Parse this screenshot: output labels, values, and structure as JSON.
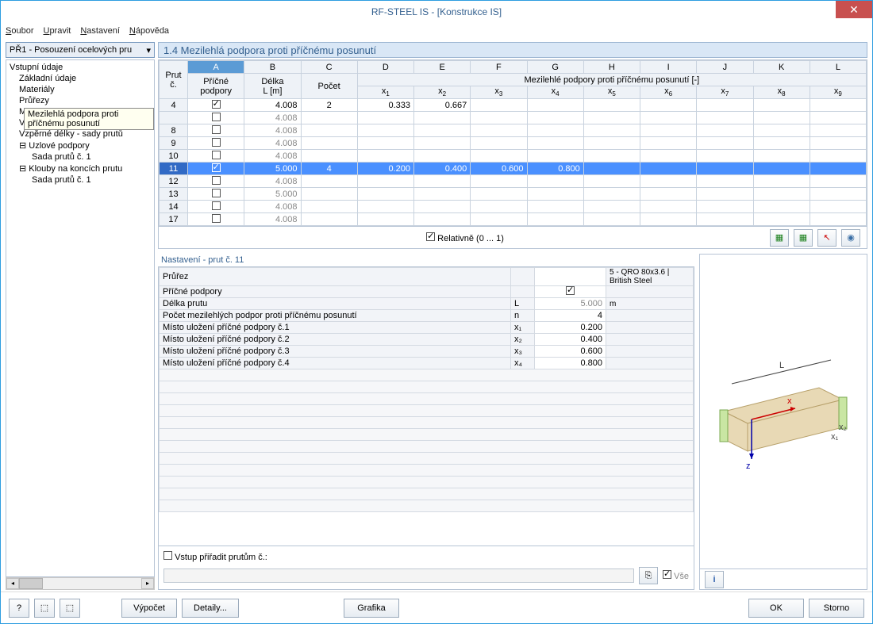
{
  "title": "RF-STEEL IS - [Konstrukce IS]",
  "menu": {
    "soubor": "Soubor",
    "upravit": "Upravit",
    "nastaveni": "Nastavení",
    "napoveda": "Nápověda"
  },
  "combo": "PŘ1 - Posouzení ocelových pru",
  "tree": {
    "root": "Vstupní údaje",
    "items": [
      "Základní údaje",
      "Materiály",
      "Průřezy",
      "Mezilehlá podpora proti příčnému posunutí",
      "Vzpěrné délky - pruty",
      "Vzpěrné délky - sady prutů"
    ],
    "uzlove": "Uzlové podpory",
    "sada1": "Sada prutů č. 1",
    "klouby": "Klouby na koncích prutu",
    "sada2": "Sada prutů č. 1",
    "tooltip": "Mezilehlá podpora proti příčnému posunutí"
  },
  "section_title": "1.4 Mezilehlá podpora proti příčnému posunutí",
  "grid": {
    "cols_letters": [
      "A",
      "B",
      "C",
      "D",
      "E",
      "F",
      "G",
      "H",
      "I",
      "J",
      "K",
      "L"
    ],
    "h_prut": "Prut č.",
    "h_pricne": "Příčné podpory",
    "h_delka": "Délka L [m]",
    "h_pocet": "Počet",
    "h_group": "Mezilehlé podpory proti příčnému posunutí [-]",
    "rows": [
      {
        "n": "4",
        "chk": true,
        "L": "4.008",
        "cnt": "2",
        "x": [
          "0.333",
          "0.667",
          "",
          "",
          "",
          "",
          "",
          "",
          ""
        ]
      },
      {
        "n": "",
        "chk": false,
        "L": "4.008",
        "cnt": "",
        "x": [
          "",
          "",
          "",
          "",
          "",
          "",
          "",
          "",
          ""
        ]
      },
      {
        "n": "8",
        "chk": false,
        "L": "4.008",
        "cnt": "",
        "x": [
          "",
          "",
          "",
          "",
          "",
          "",
          "",
          "",
          ""
        ]
      },
      {
        "n": "9",
        "chk": false,
        "L": "4.008",
        "cnt": "",
        "x": [
          "",
          "",
          "",
          "",
          "",
          "",
          "",
          "",
          ""
        ]
      },
      {
        "n": "10",
        "chk": false,
        "L": "4.008",
        "cnt": "",
        "x": [
          "",
          "",
          "",
          "",
          "",
          "",
          "",
          "",
          ""
        ]
      },
      {
        "n": "11",
        "chk": true,
        "L": "5.000",
        "cnt": "4",
        "x": [
          "0.200",
          "0.400",
          "0.600",
          "0.800",
          "",
          "",
          "",
          "",
          ""
        ],
        "sel": true
      },
      {
        "n": "12",
        "chk": false,
        "L": "4.008",
        "cnt": "",
        "x": [
          "",
          "",
          "",
          "",
          "",
          "",
          "",
          "",
          ""
        ]
      },
      {
        "n": "13",
        "chk": false,
        "L": "5.000",
        "cnt": "",
        "x": [
          "",
          "",
          "",
          "",
          "",
          "",
          "",
          "",
          ""
        ]
      },
      {
        "n": "14",
        "chk": false,
        "L": "4.008",
        "cnt": "",
        "x": [
          "",
          "",
          "",
          "",
          "",
          "",
          "",
          "",
          ""
        ]
      },
      {
        "n": "17",
        "chk": false,
        "L": "4.008",
        "cnt": "",
        "x": [
          "",
          "",
          "",
          "",
          "",
          "",
          "",
          "",
          ""
        ]
      }
    ]
  },
  "relativne": "Relativně (0 ... 1)",
  "detail": {
    "title": "Nastavení - prut č. 11",
    "rows": [
      {
        "lbl": "Průřez",
        "mid": "",
        "val": "",
        "unit": "5 - QRO 80x3.6 | British Steel",
        "type": "text"
      },
      {
        "lbl": "Příčné podpory",
        "mid": "",
        "val": "",
        "unit": "",
        "type": "check"
      },
      {
        "lbl": "Délka prutu",
        "mid": "L",
        "val": "5.000",
        "unit": "m",
        "type": "num",
        "dim": true
      },
      {
        "lbl": "Počet mezilehlých podpor proti příčnému posunutí",
        "mid": "n",
        "val": "4",
        "unit": "",
        "type": "num"
      },
      {
        "lbl": "Místo uložení příčné podpory č.1",
        "mid": "x₁",
        "val": "0.200",
        "unit": "",
        "type": "num"
      },
      {
        "lbl": "Místo uložení příčné podpory č.2",
        "mid": "x₂",
        "val": "0.400",
        "unit": "",
        "type": "num"
      },
      {
        "lbl": "Místo uložení příčné podpory č.3",
        "mid": "x₃",
        "val": "0.600",
        "unit": "",
        "type": "num"
      },
      {
        "lbl": "Místo uložení příčné podpory č.4",
        "mid": "x₄",
        "val": "0.800",
        "unit": "",
        "type": "num"
      }
    ]
  },
  "assign_label": "Vstup přiřadit prutům č.:",
  "vse": "Vše",
  "footer": {
    "vypocet": "Výpočet",
    "detaily": "Detaily...",
    "grafika": "Grafika",
    "ok": "OK",
    "storno": "Storno"
  }
}
